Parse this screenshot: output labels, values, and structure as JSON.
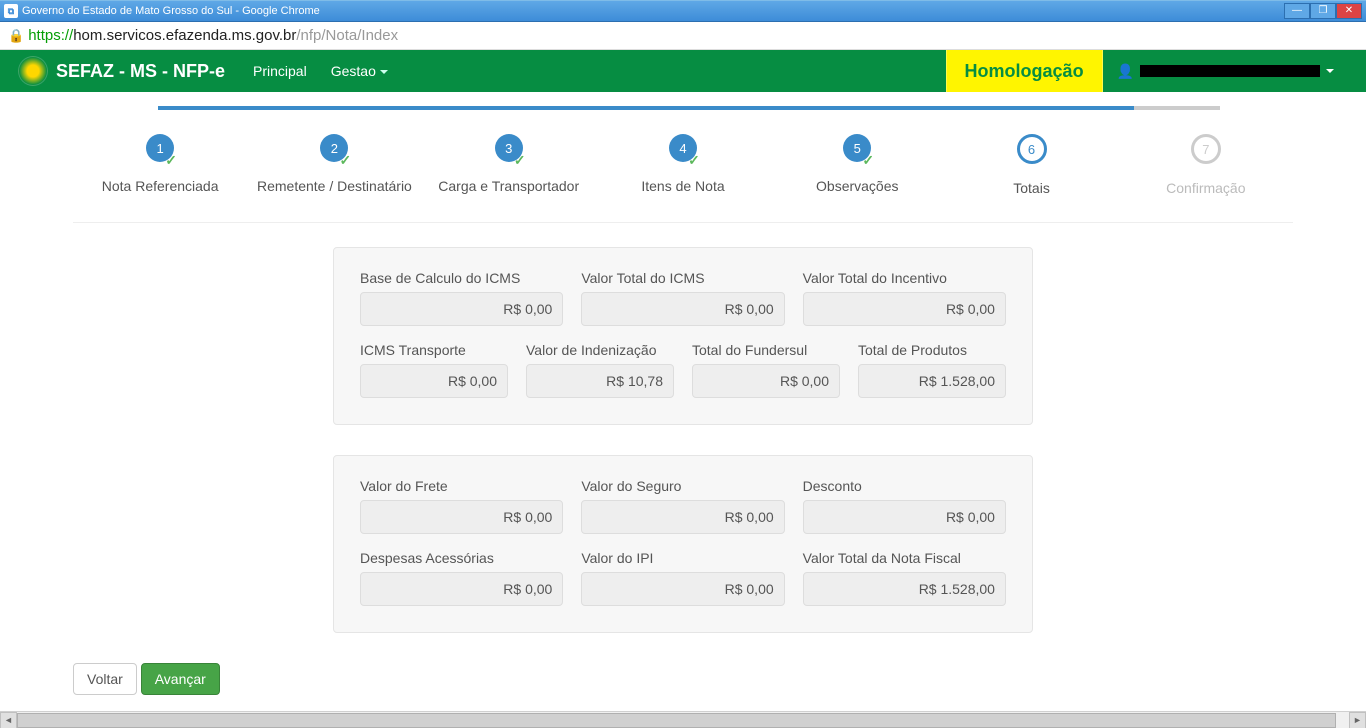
{
  "window": {
    "title": "Governo do Estado de Mato Grosso do Sul - Google Chrome"
  },
  "url": {
    "scheme": "https://",
    "host": "hom.servicos.efazenda.ms.gov.br",
    "path": "/nfp/Nota/Index"
  },
  "nav": {
    "brand": "SEFAZ - MS - NFP-e",
    "menu1": "Principal",
    "menu2": "Gestao",
    "env": "Homologação"
  },
  "steps": [
    {
      "num": "1",
      "label": "Nota Referenciada"
    },
    {
      "num": "2",
      "label": "Remetente / Destinatário"
    },
    {
      "num": "3",
      "label": "Carga e Transportador"
    },
    {
      "num": "4",
      "label": "Itens de Nota"
    },
    {
      "num": "5",
      "label": "Observações"
    },
    {
      "num": "6",
      "label": "Totais"
    },
    {
      "num": "7",
      "label": "Confirmação"
    }
  ],
  "panel1": {
    "base_icms_label": "Base de Calculo do ICMS",
    "base_icms_value": "R$ 0,00",
    "vtotal_icms_label": "Valor Total do ICMS",
    "vtotal_icms_value": "R$ 0,00",
    "vtotal_incentivo_label": "Valor Total do Incentivo",
    "vtotal_incentivo_value": "R$ 0,00",
    "icms_transp_label": "ICMS Transporte",
    "icms_transp_value": "R$ 0,00",
    "indenizacao_label": "Valor de Indenização",
    "indenizacao_value": "R$ 10,78",
    "fundersul_label": "Total do Fundersul",
    "fundersul_value": "R$ 0,00",
    "total_produtos_label": "Total de Produtos",
    "total_produtos_value": "R$ 1.528,00"
  },
  "panel2": {
    "frete_label": "Valor do Frete",
    "frete_value": "R$ 0,00",
    "seguro_label": "Valor do Seguro",
    "seguro_value": "R$ 0,00",
    "desconto_label": "Desconto",
    "desconto_value": "R$ 0,00",
    "despesas_label": "Despesas Acessórias",
    "despesas_value": "R$ 0,00",
    "ipi_label": "Valor do IPI",
    "ipi_value": "R$ 0,00",
    "total_nota_label": "Valor Total da Nota Fiscal",
    "total_nota_value": "R$ 1.528,00"
  },
  "buttons": {
    "back": "Voltar",
    "forward": "Avançar"
  }
}
